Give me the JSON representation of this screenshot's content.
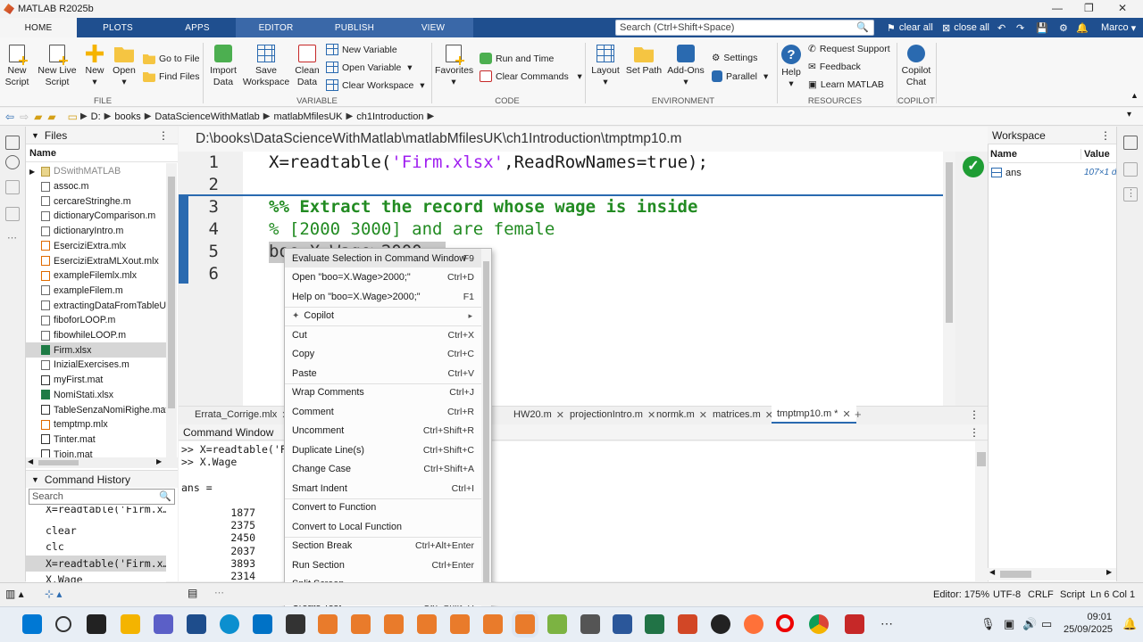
{
  "window": {
    "title": "MATLAB R2025b",
    "user": "Marco"
  },
  "ribbon_tabs": [
    "HOME",
    "PLOTS",
    "APPS",
    "EDITOR",
    "PUBLISH",
    "VIEW"
  ],
  "search": {
    "placeholder": "Search (Ctrl+Shift+Space)"
  },
  "quick_tools": {
    "clear_all": "clear all",
    "close_all": "close all"
  },
  "toolstrip": {
    "file": {
      "label": "FILE",
      "new_script": "New Script",
      "new_live_script": "New Live Script",
      "new": "New",
      "open": "Open",
      "go_to_file": "Go to File",
      "find_files": "Find Files"
    },
    "variable": {
      "label": "VARIABLE",
      "import_data": "Import Data",
      "save_workspace": "Save Workspace",
      "clean_data": "Clean Data",
      "new_variable": "New Variable",
      "open_variable": "Open Variable",
      "clear_workspace": "Clear Workspace"
    },
    "code": {
      "label": "CODE",
      "favorites": "Favorites",
      "run_and_time": "Run and Time",
      "clear_commands": "Clear Commands"
    },
    "environment": {
      "label": "ENVIRONMENT",
      "layout": "Layout",
      "set_path": "Set Path",
      "add_ons": "Add-Ons",
      "settings": "Settings",
      "parallel": "Parallel"
    },
    "resources": {
      "label": "RESOURCES",
      "help": "Help",
      "request_support": "Request Support",
      "feedback": "Feedback",
      "learn_matlab": "Learn MATLAB"
    },
    "copilot": {
      "label": "COPILOT",
      "copilot_chat": "Copilot Chat"
    }
  },
  "address_bar": [
    "D:",
    "books",
    "DataScienceWithMatlab",
    "matlabMfilesUK",
    "ch1Introduction"
  ],
  "files_panel": {
    "title": "Files",
    "column": "Name",
    "items": [
      {
        "name": "DSwithMATLAB",
        "type": "fold"
      },
      {
        "name": "assoc.m",
        "type": "m"
      },
      {
        "name": "cercareStringhe.m",
        "type": "m"
      },
      {
        "name": "dictionaryComparison.m",
        "type": "m"
      },
      {
        "name": "dictionaryIntro.m",
        "type": "m"
      },
      {
        "name": "EserciziExtra.mlx",
        "type": "mlx"
      },
      {
        "name": "EserciziExtraMLXout.mlx",
        "type": "mlx"
      },
      {
        "name": "exampleFilemlx.mlx",
        "type": "mlx"
      },
      {
        "name": "exampleFilem.m",
        "type": "m"
      },
      {
        "name": "extractingDataFromTableUsi",
        "type": "m"
      },
      {
        "name": "fiboforLOOP.m",
        "type": "m"
      },
      {
        "name": "fibowhileLOOP.m",
        "type": "m"
      },
      {
        "name": "Firm.xlsx",
        "type": "xlsx"
      },
      {
        "name": "InizialExercises.m",
        "type": "m"
      },
      {
        "name": "myFirst.mat",
        "type": "mat"
      },
      {
        "name": "NomiStati.xlsx",
        "type": "xlsx"
      },
      {
        "name": "TableSenzaNomiRighe.mat",
        "type": "mat"
      },
      {
        "name": "temptmp.mlx",
        "type": "mlx"
      },
      {
        "name": "Tinter.mat",
        "type": "mat"
      },
      {
        "name": "Tjoin.mat",
        "type": "mat"
      }
    ]
  },
  "command_history": {
    "title": "Command History",
    "search_placeholder": "Search",
    "items": [
      "X=readtable('Firm.x…",
      "clear",
      "clc",
      "X=readtable('Firm.x…",
      "X.Wage"
    ]
  },
  "editor": {
    "path": "D:\\books\\DataScienceWithMatlab\\matlabMfilesUK\\ch1Introduction\\tmptmp10.m",
    "line_numbers": [
      "1",
      "2",
      "3",
      "4",
      "5",
      "6"
    ],
    "line1_pre": "X=readtable(",
    "line1_str": "'Firm.xlsx'",
    "line1_post": ",ReadRowNames=true);",
    "line3": "%% Extract the record whose wage is inside",
    "line4": "% [2000 3000] and are female",
    "line5": "boo=X.Wage>2000;"
  },
  "editor_tabs": [
    "Errata_Corrige.mlx",
    "HW20.m",
    "projectionIntro.m",
    "normk.m",
    "matrices.m",
    "tmptmp10.m *"
  ],
  "command_window": {
    "title": "Command Window",
    "lines": [
      ">> X=readtable('Fi",
      ">> X.Wage",
      "",
      "ans =",
      "",
      "        1877",
      "        2375",
      "        2450",
      "        2037",
      "        3893",
      "        2314"
    ]
  },
  "workspace": {
    "title": "Workspace",
    "col_name": "Name",
    "col_value": "Value",
    "var_name": "ans",
    "var_value": "107×1 d"
  },
  "context_menu": [
    {
      "label": "Evaluate Selection in Command Window",
      "shortcut": "F9"
    },
    {
      "label": "Open \"boo=X.Wage>2000;\"",
      "shortcut": "Ctrl+D"
    },
    {
      "label": "Help on \"boo=X.Wage>2000;\"",
      "shortcut": "F1"
    },
    {
      "label": "Copilot",
      "shortcut": "",
      "submenu": true
    },
    {
      "label": "Cut",
      "shortcut": "Ctrl+X"
    },
    {
      "label": "Copy",
      "shortcut": "Ctrl+C"
    },
    {
      "label": "Paste",
      "shortcut": "Ctrl+V"
    },
    {
      "label": "Wrap Comments",
      "shortcut": "Ctrl+J"
    },
    {
      "label": "Comment",
      "shortcut": "Ctrl+R"
    },
    {
      "label": "Uncomment",
      "shortcut": "Ctrl+Shift+R"
    },
    {
      "label": "Duplicate Line(s)",
      "shortcut": "Ctrl+Shift+C"
    },
    {
      "label": "Change Case",
      "shortcut": "Ctrl+Shift+A"
    },
    {
      "label": "Smart Indent",
      "shortcut": "Ctrl+I"
    },
    {
      "label": "Convert to Function",
      "shortcut": ""
    },
    {
      "label": "Convert to Local Function",
      "shortcut": ""
    },
    {
      "label": "Section Break",
      "shortcut": "Ctrl+Alt+Enter"
    },
    {
      "label": "Run Section",
      "shortcut": "Ctrl+Enter"
    },
    {
      "label": "Split Screen",
      "shortcut": "",
      "submenu": true
    },
    {
      "label": "Create Test",
      "shortcut": "Ctrl+Shift+H"
    }
  ],
  "statusbar": {
    "zoom": "Editor: 175%",
    "encoding": "UTF-8",
    "eol": "CRLF",
    "mode": "Script",
    "position": "Ln 6  Col 1"
  },
  "taskbar": {
    "time": "09:01",
    "date": "25/09/2025"
  }
}
